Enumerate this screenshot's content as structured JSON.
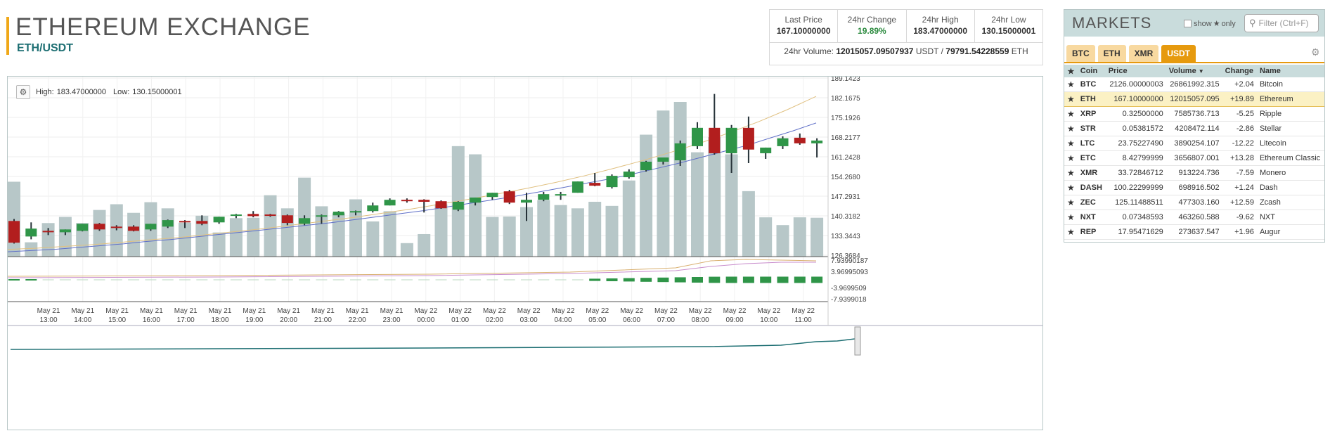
{
  "header": {
    "title": "ETHEREUM EXCHANGE",
    "pair": "ETH/USDT"
  },
  "stats": {
    "last_price_label": "Last Price",
    "last_price": "167.10000000",
    "change_label": "24hr Change",
    "change": "19.89%",
    "high_label": "24hr High",
    "high": "183.47000000",
    "low_label": "24hr Low",
    "low": "130.15000001",
    "volume_label": "24hr Volume:",
    "volume_usdt": "12015057.09507937",
    "volume_usdt_unit": "USDT /",
    "volume_eth": "79791.54228559",
    "volume_eth_unit": "ETH"
  },
  "chart": {
    "high_label": "High:",
    "high_value": "183.47000000",
    "low_label": "Low:",
    "low_value": "130.15000001",
    "colors": {
      "up": "#2f9548",
      "down": "#b21e1e",
      "volume": "#b7c7c8",
      "ema_slow": "#6070c8",
      "ema_fast": "#e0c080"
    }
  },
  "chart_data": {
    "type": "candlestick",
    "y_ticks": [
      "189.1423",
      "182.1675",
      "175.1926",
      "168.2177",
      "161.2428",
      "154.2680",
      "147.2931",
      "140.3182",
      "133.3443",
      "126.3684"
    ],
    "ylim": [
      126.3684,
      189.1423
    ],
    "macd_ticks": [
      "7.93990187",
      "3.96995093",
      "-3.9699509",
      "-7.9399018"
    ],
    "x_ticks": [
      {
        "d": "May 21",
        "t": "13:00"
      },
      {
        "d": "May 21",
        "t": "14:00"
      },
      {
        "d": "May 21",
        "t": "15:00"
      },
      {
        "d": "May 21",
        "t": "16:00"
      },
      {
        "d": "May 21",
        "t": "17:00"
      },
      {
        "d": "May 21",
        "t": "18:00"
      },
      {
        "d": "May 21",
        "t": "19:00"
      },
      {
        "d": "May 21",
        "t": "20:00"
      },
      {
        "d": "May 21",
        "t": "21:00"
      },
      {
        "d": "May 21",
        "t": "22:00"
      },
      {
        "d": "May 21",
        "t": "23:00"
      },
      {
        "d": "May 22",
        "t": "00:00"
      },
      {
        "d": "May 22",
        "t": "01:00"
      },
      {
        "d": "May 22",
        "t": "02:00"
      },
      {
        "d": "May 22",
        "t": "03:00"
      },
      {
        "d": "May 22",
        "t": "04:00"
      },
      {
        "d": "May 22",
        "t": "05:00"
      },
      {
        "d": "May 22",
        "t": "06:00"
      },
      {
        "d": "May 22",
        "t": "07:00"
      },
      {
        "d": "May 22",
        "t": "08:00"
      },
      {
        "d": "May 22",
        "t": "09:00"
      },
      {
        "d": "May 22",
        "t": "10:00"
      },
      {
        "d": "May 22",
        "t": "11:00"
      }
    ],
    "candles": [
      {
        "o": 138.5,
        "h": 139.2,
        "c": 130.8,
        "l": 130.5
      },
      {
        "o": 133.0,
        "h": 138.0,
        "c": 135.8,
        "l": 132.0
      },
      {
        "o": 135.0,
        "h": 136.0,
        "c": 134.5,
        "l": 133.5
      },
      {
        "o": 134.5,
        "h": 135.5,
        "c": 135.5,
        "l": 133.5
      },
      {
        "o": 135.0,
        "h": 137.5,
        "c": 137.5,
        "l": 134.8
      },
      {
        "o": 137.5,
        "h": 137.8,
        "c": 135.5,
        "l": 135.0
      },
      {
        "o": 136.5,
        "h": 137.0,
        "c": 136.0,
        "l": 135.2
      },
      {
        "o": 136.5,
        "h": 137.0,
        "c": 135.0,
        "l": 134.8
      },
      {
        "o": 135.5,
        "h": 137.5,
        "c": 137.5,
        "l": 135.0
      },
      {
        "o": 136.5,
        "h": 139.0,
        "c": 138.8,
        "l": 136.0
      },
      {
        "o": 138.5,
        "h": 138.8,
        "c": 138.3,
        "l": 136.0
      },
      {
        "o": 138.5,
        "h": 140.5,
        "c": 137.5,
        "l": 137.0
      },
      {
        "o": 138.0,
        "h": 140.0,
        "c": 140.0,
        "l": 137.5
      },
      {
        "o": 140.5,
        "h": 141.0,
        "c": 140.8,
        "l": 139.5
      },
      {
        "o": 141.0,
        "h": 142.0,
        "c": 140.2,
        "l": 139.8
      },
      {
        "o": 140.8,
        "h": 141.0,
        "c": 140.3,
        "l": 140.0
      },
      {
        "o": 140.5,
        "h": 140.8,
        "c": 137.8,
        "l": 137.0
      },
      {
        "o": 137.5,
        "h": 140.5,
        "c": 139.5,
        "l": 137.0
      },
      {
        "o": 140.0,
        "h": 140.8,
        "c": 140.5,
        "l": 137.5
      },
      {
        "o": 140.5,
        "h": 142.0,
        "c": 141.8,
        "l": 139.8
      },
      {
        "o": 141.8,
        "h": 142.2,
        "c": 142.0,
        "l": 140.5
      },
      {
        "o": 142.0,
        "h": 145.0,
        "c": 144.0,
        "l": 141.5
      },
      {
        "o": 144.0,
        "h": 146.5,
        "c": 146.0,
        "l": 144.0
      },
      {
        "o": 146.0,
        "h": 146.5,
        "c": 145.8,
        "l": 145.0
      },
      {
        "o": 146.0,
        "h": 146.2,
        "c": 145.3,
        "l": 141.5
      },
      {
        "o": 145.5,
        "h": 145.8,
        "c": 143.0,
        "l": 142.8
      },
      {
        "o": 142.5,
        "h": 145.5,
        "c": 145.3,
        "l": 142.0
      },
      {
        "o": 145.0,
        "h": 146.8,
        "c": 146.8,
        "l": 144.0
      },
      {
        "o": 147.0,
        "h": 148.5,
        "c": 148.5,
        "l": 146.0
      },
      {
        "o": 149.0,
        "h": 149.5,
        "c": 145.0,
        "l": 144.5
      },
      {
        "o": 145.0,
        "h": 148.5,
        "c": 146.0,
        "l": 138.5
      },
      {
        "o": 146.0,
        "h": 148.8,
        "c": 148.0,
        "l": 145.5
      },
      {
        "o": 147.8,
        "h": 148.8,
        "c": 148.0,
        "l": 146.0
      },
      {
        "o": 148.5,
        "h": 152.5,
        "c": 152.5,
        "l": 148.5
      },
      {
        "o": 152.0,
        "h": 155.5,
        "c": 151.0,
        "l": 150.8
      },
      {
        "o": 150.5,
        "h": 155.0,
        "c": 154.5,
        "l": 150.0
      },
      {
        "o": 154.0,
        "h": 156.8,
        "c": 156.0,
        "l": 153.5
      },
      {
        "o": 156.5,
        "h": 159.8,
        "c": 159.5,
        "l": 156.0
      },
      {
        "o": 159.5,
        "h": 160.8,
        "c": 161.0,
        "l": 158.5
      },
      {
        "o": 160.0,
        "h": 167.0,
        "c": 166.0,
        "l": 158.0
      },
      {
        "o": 165.0,
        "h": 173.5,
        "c": 171.5,
        "l": 164.0
      },
      {
        "o": 171.5,
        "h": 183.5,
        "c": 162.5,
        "l": 162.0
      },
      {
        "o": 162.5,
        "h": 172.5,
        "c": 171.5,
        "l": 155.5
      },
      {
        "o": 171.5,
        "h": 175.5,
        "c": 163.8,
        "l": 159.0
      },
      {
        "o": 162.5,
        "h": 164.5,
        "c": 164.5,
        "l": 160.5
      },
      {
        "o": 165.0,
        "h": 168.5,
        "c": 167.8,
        "l": 164.0
      },
      {
        "o": 168.0,
        "h": 169.5,
        "c": 166.0,
        "l": 165.5
      },
      {
        "o": 166.0,
        "h": 167.8,
        "c": 167.0,
        "l": 161.0
      }
    ],
    "volume": [
      183,
      35,
      82,
      97,
      82,
      114,
      128,
      107,
      133,
      118,
      83,
      100,
      59,
      94,
      95,
      150,
      118,
      193,
      123,
      106,
      140,
      86,
      111,
      33,
      55,
      128,
      270,
      250,
      97,
      98,
      121,
      138,
      126,
      118,
      134,
      124,
      186,
      298,
      357,
      378,
      255,
      292,
      250,
      160,
      96,
      77,
      96,
      95
    ],
    "ema_slow": [
      8,
      10,
      12,
      15,
      18,
      21,
      25,
      28,
      32,
      36,
      40,
      44,
      48,
      52,
      56,
      61,
      66,
      71,
      76,
      82,
      88,
      94,
      100,
      107,
      114,
      121,
      128,
      136,
      145,
      154,
      164,
      174,
      184,
      196,
      208,
      221
    ],
    "ema_fast": [
      12,
      14,
      17,
      20,
      24,
      28,
      32,
      37,
      42,
      47,
      53,
      59,
      65,
      72,
      79,
      87,
      95,
      104,
      113,
      123,
      134,
      146,
      159,
      173,
      188,
      205,
      223,
      243,
      265
    ]
  },
  "markets": {
    "title": "MARKETS",
    "show_label": "show",
    "only_label": "only",
    "filter_placeholder": "Filter (Ctrl+F)",
    "tabs": [
      "BTC",
      "ETH",
      "XMR",
      "USDT"
    ],
    "columns": [
      "Coin",
      "Price",
      "Volume",
      "Change",
      "Name"
    ],
    "rows": [
      {
        "coin": "BTC",
        "price": "2126.00000003",
        "volume": "26861992.315",
        "change": "+2.04",
        "name": "Bitcoin"
      },
      {
        "coin": "ETH",
        "price": "167.10000000",
        "volume": "12015057.095",
        "change": "+19.89",
        "name": "Ethereum"
      },
      {
        "coin": "XRP",
        "price": "0.32500000",
        "volume": "7585736.713",
        "change": "-5.25",
        "name": "Ripple"
      },
      {
        "coin": "STR",
        "price": "0.05381572",
        "volume": "4208472.114",
        "change": "-2.86",
        "name": "Stellar"
      },
      {
        "coin": "LTC",
        "price": "23.75227490",
        "volume": "3890254.107",
        "change": "-12.22",
        "name": "Litecoin"
      },
      {
        "coin": "ETC",
        "price": "8.42799999",
        "volume": "3656807.001",
        "change": "+13.28",
        "name": "Ethereum Classic"
      },
      {
        "coin": "XMR",
        "price": "33.72846712",
        "volume": "913224.736",
        "change": "-7.59",
        "name": "Monero"
      },
      {
        "coin": "DASH",
        "price": "100.22299999",
        "volume": "698916.502",
        "change": "+1.24",
        "name": "Dash"
      },
      {
        "coin": "ZEC",
        "price": "125.11488511",
        "volume": "477303.160",
        "change": "+12.59",
        "name": "Zcash"
      },
      {
        "coin": "NXT",
        "price": "0.07348593",
        "volume": "463260.588",
        "change": "-9.62",
        "name": "NXT"
      },
      {
        "coin": "REP",
        "price": "17.95471629",
        "volume": "273637.547",
        "change": "+1.96",
        "name": "Augur"
      }
    ]
  }
}
